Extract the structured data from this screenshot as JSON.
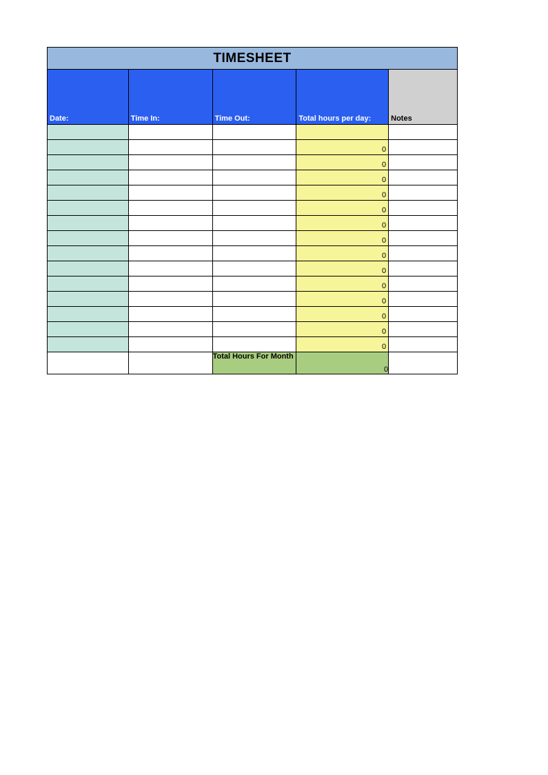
{
  "title": "TIMESHEET",
  "headers": {
    "date": "Date:",
    "time_in": "Time In:",
    "time_out": "Time Out:",
    "total_per_day": "Total hours per day:",
    "notes": "Notes"
  },
  "rows": [
    {
      "date": "",
      "time_in": "",
      "time_out": "",
      "total": "",
      "notes": ""
    },
    {
      "date": "",
      "time_in": "",
      "time_out": "",
      "total": "0",
      "notes": ""
    },
    {
      "date": "",
      "time_in": "",
      "time_out": "",
      "total": "0",
      "notes": ""
    },
    {
      "date": "",
      "time_in": "",
      "time_out": "",
      "total": "0",
      "notes": ""
    },
    {
      "date": "",
      "time_in": "",
      "time_out": "",
      "total": "0",
      "notes": ""
    },
    {
      "date": "",
      "time_in": "",
      "time_out": "",
      "total": "0",
      "notes": ""
    },
    {
      "date": "",
      "time_in": "",
      "time_out": "",
      "total": "0",
      "notes": ""
    },
    {
      "date": "",
      "time_in": "",
      "time_out": "",
      "total": "0",
      "notes": ""
    },
    {
      "date": "",
      "time_in": "",
      "time_out": "",
      "total": "0",
      "notes": ""
    },
    {
      "date": "",
      "time_in": "",
      "time_out": "",
      "total": "0",
      "notes": ""
    },
    {
      "date": "",
      "time_in": "",
      "time_out": "",
      "total": "0",
      "notes": ""
    },
    {
      "date": "",
      "time_in": "",
      "time_out": "",
      "total": "0",
      "notes": ""
    },
    {
      "date": "",
      "time_in": "",
      "time_out": "",
      "total": "0",
      "notes": ""
    },
    {
      "date": "",
      "time_in": "",
      "time_out": "",
      "total": "0",
      "notes": ""
    },
    {
      "date": "",
      "time_in": "",
      "time_out": "",
      "total": "0",
      "notes": ""
    }
  ],
  "summary": {
    "label": "Total Hours For Month",
    "value": "0"
  }
}
